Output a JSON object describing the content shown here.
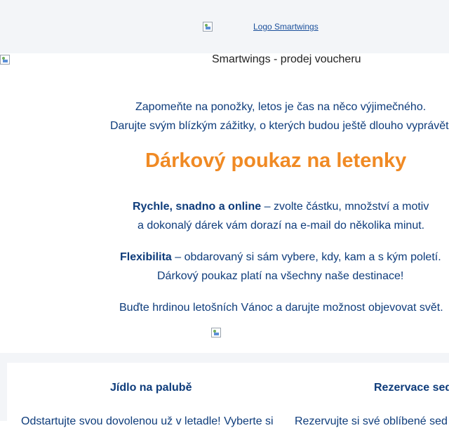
{
  "header": {
    "logo_alt": "Logo Smartwings"
  },
  "hero": {
    "image_alt": "Smartwings - prodej voucheru"
  },
  "intro": {
    "line1": "Zapomeňte na ponožky, letos je čas na něco výjimečného.",
    "line2": "Darujte svým blízkým zážitky, o kterých budou ještě dlouho vyprávět"
  },
  "headline": "Dárkový poukaz na letenky",
  "benefits": {
    "b1_bold": "Rychle, snadno a online",
    "b1_rest": " – zvolte částku, množství a motiv",
    "b1_line2": "a dokonalý dárek vám dorazí na e-mail do několika minut.",
    "b2_bold": "Flexibilita",
    "b2_rest": " – obdarovaný si sám vybere, kdy, kam a s kým poletí.",
    "b2_line2": "Dárkový poukaz platí na všechny naše destinace!",
    "closing": "Buďte hrdinou letošních Vánoc a darujte možnost objevovat svět."
  },
  "cards": [
    {
      "title": "Jídlo na palubě",
      "text": "Odstartujte svou dovolenou už v letadle! Vyberte si"
    },
    {
      "title": "Rezervace sed",
      "text": "Rezervujte si své oblíbené sed"
    }
  ]
}
